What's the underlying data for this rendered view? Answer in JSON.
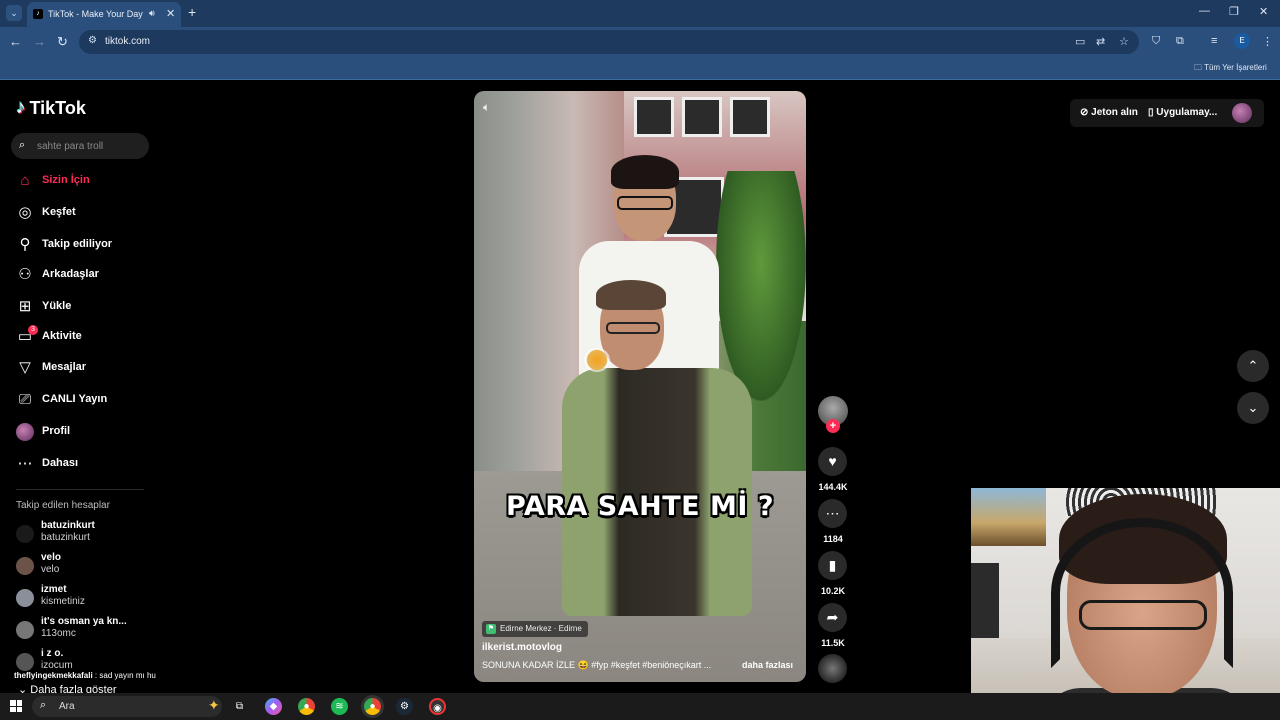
{
  "browser": {
    "tab_title": "TikTok - Make Your Day",
    "url": "tiktok.com",
    "bookmarks_label": "Tüm Yer İşaretleri",
    "profile_initial": "E"
  },
  "sidebar": {
    "logo": "TikTok",
    "search_placeholder": "sahte para troll",
    "nav": [
      {
        "label": "Sizin İçin",
        "icon": "home-icon",
        "active": true
      },
      {
        "label": "Keşfet",
        "icon": "compass-icon"
      },
      {
        "label": "Takip ediliyor",
        "icon": "person-follow-icon"
      },
      {
        "label": "Arkadaşlar",
        "icon": "friends-icon"
      },
      {
        "label": "Yükle",
        "icon": "upload-icon"
      },
      {
        "label": "Aktivite",
        "icon": "activity-icon",
        "badge": "3"
      },
      {
        "label": "Mesajlar",
        "icon": "messages-icon"
      },
      {
        "label": "CANLI Yayın",
        "icon": "live-icon"
      },
      {
        "label": "Profil",
        "icon": "avatar"
      },
      {
        "label": "Dahası",
        "icon": "more-icon"
      }
    ],
    "following_title": "Takip edilen hesaplar",
    "following": [
      {
        "name": "batuzinkurt",
        "handle": "batuzinkurt"
      },
      {
        "name": "velo",
        "handle": "velo"
      },
      {
        "name": "izmet",
        "handle": "kismetiniz"
      },
      {
        "name": "it's osman ya kn...",
        "handle": "113omc"
      },
      {
        "name": "i z o.",
        "handle": "izocum"
      }
    ],
    "chat_user": "theflyingekmekkafali",
    "chat_text": " : sad yayın mı hu",
    "more_label": "Daha fazla göster"
  },
  "video": {
    "overlay_text": "PARA SAHTE Mİ ?",
    "location": "Edirne Merkez · Edirne",
    "author": "ilkerist.motovlog",
    "caption": "SONUNA KADAR İZLE 😆 #fyp  #keşfet  #beniöneçıkart  ...",
    "more_label": "daha fazlası"
  },
  "actions": {
    "likes": "144.4K",
    "comments": "1184",
    "saves": "10.2K",
    "shares": "11.5K"
  },
  "topbar": {
    "coins_label": "Jeton alın",
    "app_label": "Uygulamay..."
  },
  "taskbar": {
    "search_label": "Ara"
  },
  "colors": {
    "accent": "#fe2c55",
    "browser_chrome": "#2a4f7c"
  }
}
